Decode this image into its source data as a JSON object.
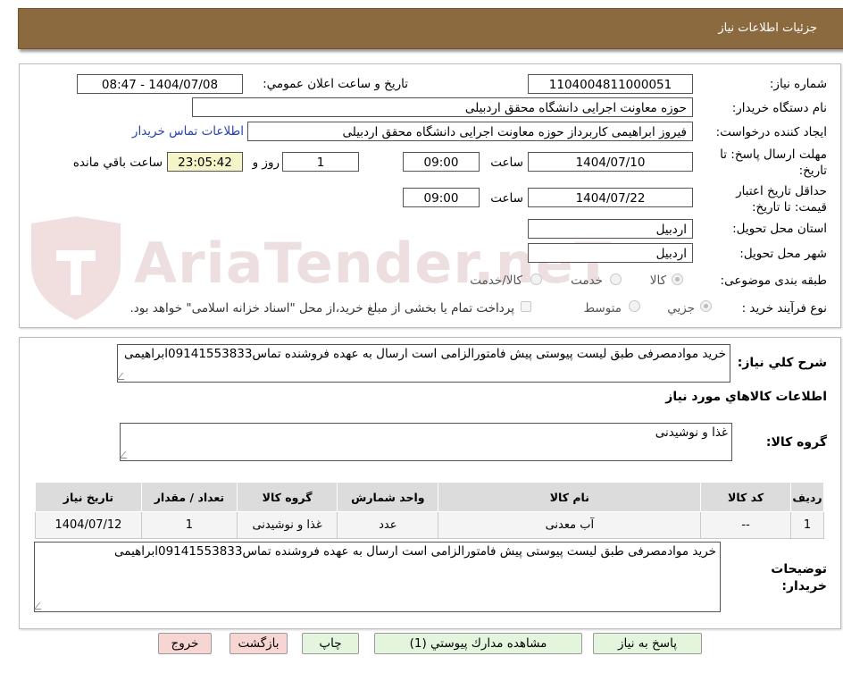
{
  "header": {
    "title": "جزئیات اطلاعات نیاز"
  },
  "watermark": {
    "text": "AriaTender.neT"
  },
  "form": {
    "need_number_label": "شماره نیاز:",
    "need_number": "1104004811000051",
    "announce_label": "تاریخ و ساعت اعلان عمومي:",
    "announce_value": "1404/07/08 - 08:47",
    "buyer_label": "نام دستگاه خریدار:",
    "buyer_value": "حوزه معاونت اجرایی دانشگاه محقق اردبیلی",
    "creator_label": "ایجاد کننده درخواست:",
    "creator_value": "فیروز ابراهیمی کاربرداز حوزه معاونت اجرایی دانشگاه محقق اردبیلی",
    "contact_link": "اطلاعات تماس خریدار",
    "deadline_label": "مهلت ارسال پاسخ: تا تاریخ:",
    "deadline_date": "1404/07/10",
    "hour_label": "ساعت",
    "deadline_time": "09:00",
    "days_value": "1",
    "days_label": "روز و",
    "remaining_time": "23:05:42",
    "remaining_label": "ساعت باقي مانده",
    "validity_label": "حداقل تاریخ اعتبار قیمت: تا تاریخ:",
    "validity_date": "1404/07/22",
    "validity_hour_label": "ساعت",
    "validity_time": "09:00",
    "province_label": "استان محل تحویل:",
    "province_value": "اردبیل",
    "city_label": "شهر محل تحویل:",
    "city_value": "اردبیل",
    "category_label": "طبقه بندی موضوعی:",
    "category_options": [
      "کالا",
      "خدمت",
      "کالا/خدمت"
    ],
    "category_selected": "کالا",
    "process_label": "نوع فرآیند خرید :",
    "process_options": [
      "جزیي",
      "متوسط"
    ],
    "process_selected": "جزیي",
    "payment_note": "پرداخت تمام یا بخشی از مبلغ خرید،از محل \"اسناد خزانه اسلامی\" خواهد بود."
  },
  "summary": {
    "label": "شرح كلي نیاز:",
    "text": "خرید موادمصرفی طبق لیست پیوستی پیش فامتورالزامی است ارسال به عهده فروشنده تماس09141553833ابراهیمی",
    "goods_info_label": "اطلاعات كالاهاي مورد نیاز",
    "group_label": "گروه کالا:",
    "group_value": "غذا و نوشیدنی"
  },
  "table": {
    "headers": [
      "ردیف",
      "کد کالا",
      "نام کالا",
      "واحد شمارش",
      "گروه کالا",
      "تعداد / مقدار",
      "تاریخ نیاز"
    ],
    "rows": [
      [
        "1",
        "--",
        "آب معدنی",
        "عدد",
        "غذا و نوشیدنی",
        "1",
        "1404/07/12"
      ]
    ]
  },
  "buyer_notes": {
    "label": "توضیحات خریدار:",
    "text": "خرید موادمصرفی طبق لیست پیوستی پیش فامتورالزامی است ارسال به عهده فروشنده تماس09141553833ابراهیمی"
  },
  "buttons": {
    "reply": "پاسخ به نیاز",
    "attachments": "مشاهده مدارك پیوستي (1)",
    "print": "چاپ",
    "back": "بازگشت",
    "exit": "خروج"
  },
  "colors": {
    "header_bg": "#8a6a3e",
    "link": "#2541b2",
    "remaining_bg": "#f5f4c8"
  }
}
